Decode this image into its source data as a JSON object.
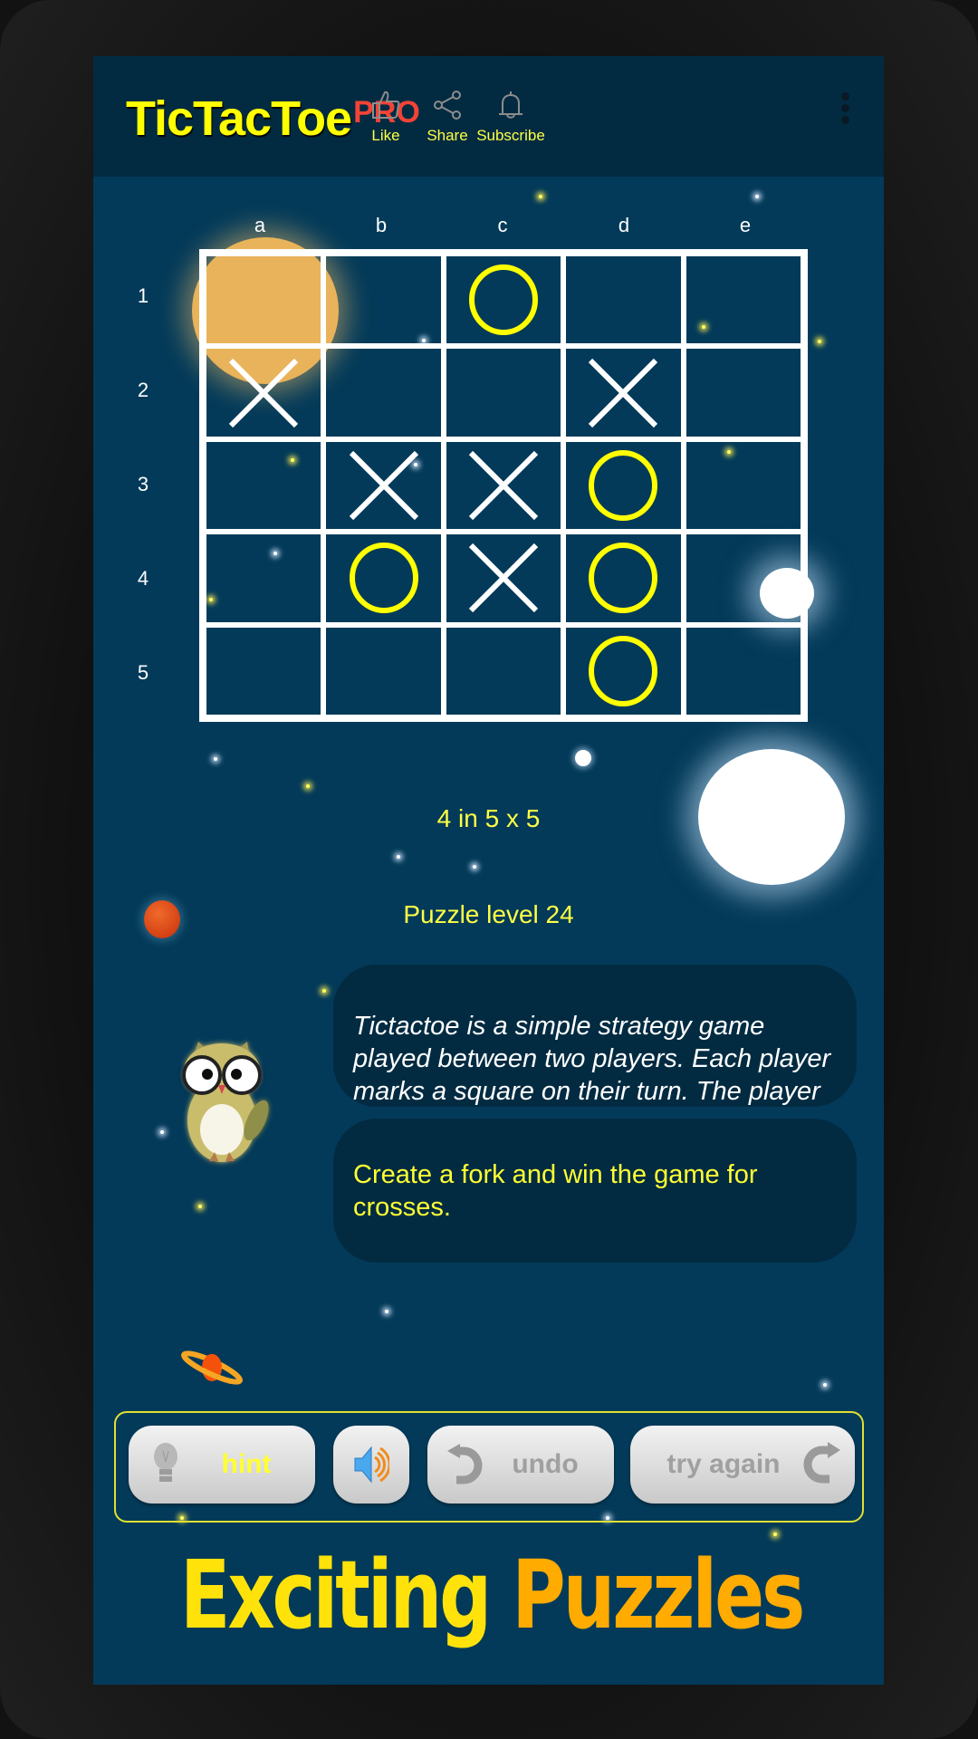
{
  "app": {
    "title_main": "TicTacToe",
    "title_suffix": "PRO"
  },
  "header": {
    "actions": [
      {
        "label": "Like",
        "icon": "thumbs-up-icon"
      },
      {
        "label": "Share",
        "icon": "share-icon"
      },
      {
        "label": "Subscribe",
        "icon": "bell-icon"
      }
    ],
    "menu_icon": "more-vertical-icon"
  },
  "board": {
    "columns": [
      "a",
      "b",
      "c",
      "d",
      "e"
    ],
    "rows": [
      "1",
      "2",
      "3",
      "4",
      "5"
    ],
    "cells": [
      [
        "",
        "",
        "O",
        "",
        ""
      ],
      [
        "X",
        "",
        "",
        "X",
        ""
      ],
      [
        "",
        "X",
        "X",
        "O",
        ""
      ],
      [
        "",
        "O",
        "X",
        "O",
        ""
      ],
      [
        "",
        "",
        "",
        "O",
        ""
      ]
    ],
    "x_color": "#ffffff",
    "o_color": "#ffff00"
  },
  "game": {
    "mode": "4 in 5 x 5",
    "level": "Puzzle level 24"
  },
  "messages": {
    "description": "Tictactoe is a simple strategy game played between two players. Each player marks a square on their turn. The player",
    "objective": "Create a fork and win the game for crosses."
  },
  "controls": {
    "hint_label": "hint",
    "sound_icon": "speaker-icon",
    "undo_label": "undo",
    "retry_label": "try again"
  },
  "promo": {
    "word1": "Exciting",
    "word2": "Puzzles"
  },
  "colors": {
    "background": "#033a59",
    "header": "#022b42",
    "accent_yellow": "#ffff00",
    "pro_red": "#f44336"
  }
}
